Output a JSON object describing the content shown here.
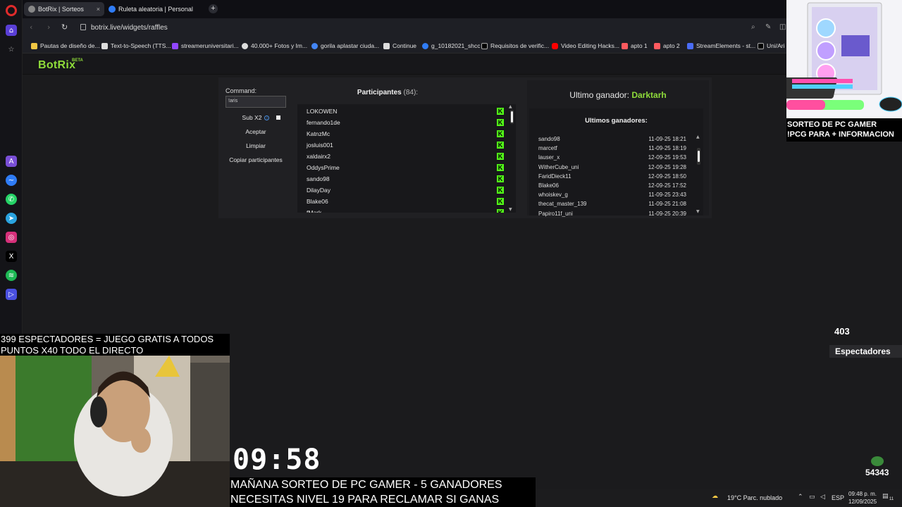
{
  "browser": {
    "tabs": [
      {
        "title": "BotRix | Sorteos",
        "active": true
      },
      {
        "title": "Ruleta aleatoria | Personal",
        "active": false
      }
    ],
    "url": "botrix.live/widgets/raffles",
    "bookmarks": [
      "Pautas de diseño de...",
      "Text-to-Speech (TTS...",
      "streameruniversitari...",
      "40.000+ Fotos y Im...",
      "gorila aplastar ciuda...",
      "Continue",
      "g_10182021_shcc",
      "Requisitos de verific...",
      "Video Editing Hacks...",
      "apto 1",
      "apto 2",
      "StreamElements - st...",
      "Uni/Ari"
    ]
  },
  "app": {
    "logo": "BotRix",
    "beta": "BETA",
    "command_label": "Command:",
    "command_value": "!aris",
    "sub_label": "Sub X2",
    "accept_label": "Aceptar",
    "clear_label": "Limpiar",
    "copy_label": "Copiar participantes",
    "participants_title": "Participantes",
    "participants_count": "(84):",
    "participants": [
      "LOKOWEN",
      "fernando1de",
      "KatnzMc",
      "josluis001",
      "xaldairx2",
      "OddysPrime",
      "sando98",
      "DilayDay",
      "Blake06",
      "fMark"
    ],
    "last_winner_label": "Ultimo ganador:",
    "last_winner_name": "Darktarh",
    "last_winners_title": "Ultimos ganadores:",
    "last_winners": [
      {
        "name": "sando98",
        "date": "11-09-25 18:21"
      },
      {
        "name": "marcetf",
        "date": "11-09-25 18:19"
      },
      {
        "name": "lauser_x",
        "date": "12-09-25 19:53"
      },
      {
        "name": "WitherCube_uni",
        "date": "12-09-25 19:28"
      },
      {
        "name": "FaridDieck11",
        "date": "12-09-25 18:50"
      },
      {
        "name": "Blake06",
        "date": "12-09-25 17:52"
      },
      {
        "name": "whoiskev_g",
        "date": "11-09-25 23:43"
      },
      {
        "name": "thecat_master_139",
        "date": "11-09-25 21:08"
      },
      {
        "name": "Papiro11f_uni",
        "date": "11-09-25 20:39"
      }
    ]
  },
  "overlay": {
    "viewers_line1": "399 ESPECTADORES = JUEGO GRATIS A TODOS",
    "viewers_line2": "PUNTOS X40 TODO EL DIRECTO",
    "timer": "09:58",
    "bottom_line1": "MAÑANA SORTEO DE PC GAMER - 5 GANADORES",
    "bottom_line2": "NECESITAS NIVEL 19 PARA RECLAMAR SI GANAS",
    "promo_line1": "SORTEO DE PC GAMER",
    "promo_line2": "!PCG PARA + INFORMACION",
    "view_count": "403",
    "view_label": "Espectadores",
    "points": "54343"
  },
  "taskbar": {
    "weather": "19°C  Parc. nublado",
    "lang": "ESP",
    "time": "09:48 p. m.",
    "date": "12/09/2025",
    "notif_count": "11"
  },
  "colors": {
    "accent_green": "#8fdc3a",
    "kick_green": "#53fc18",
    "opera_red": "#e02b2b"
  }
}
